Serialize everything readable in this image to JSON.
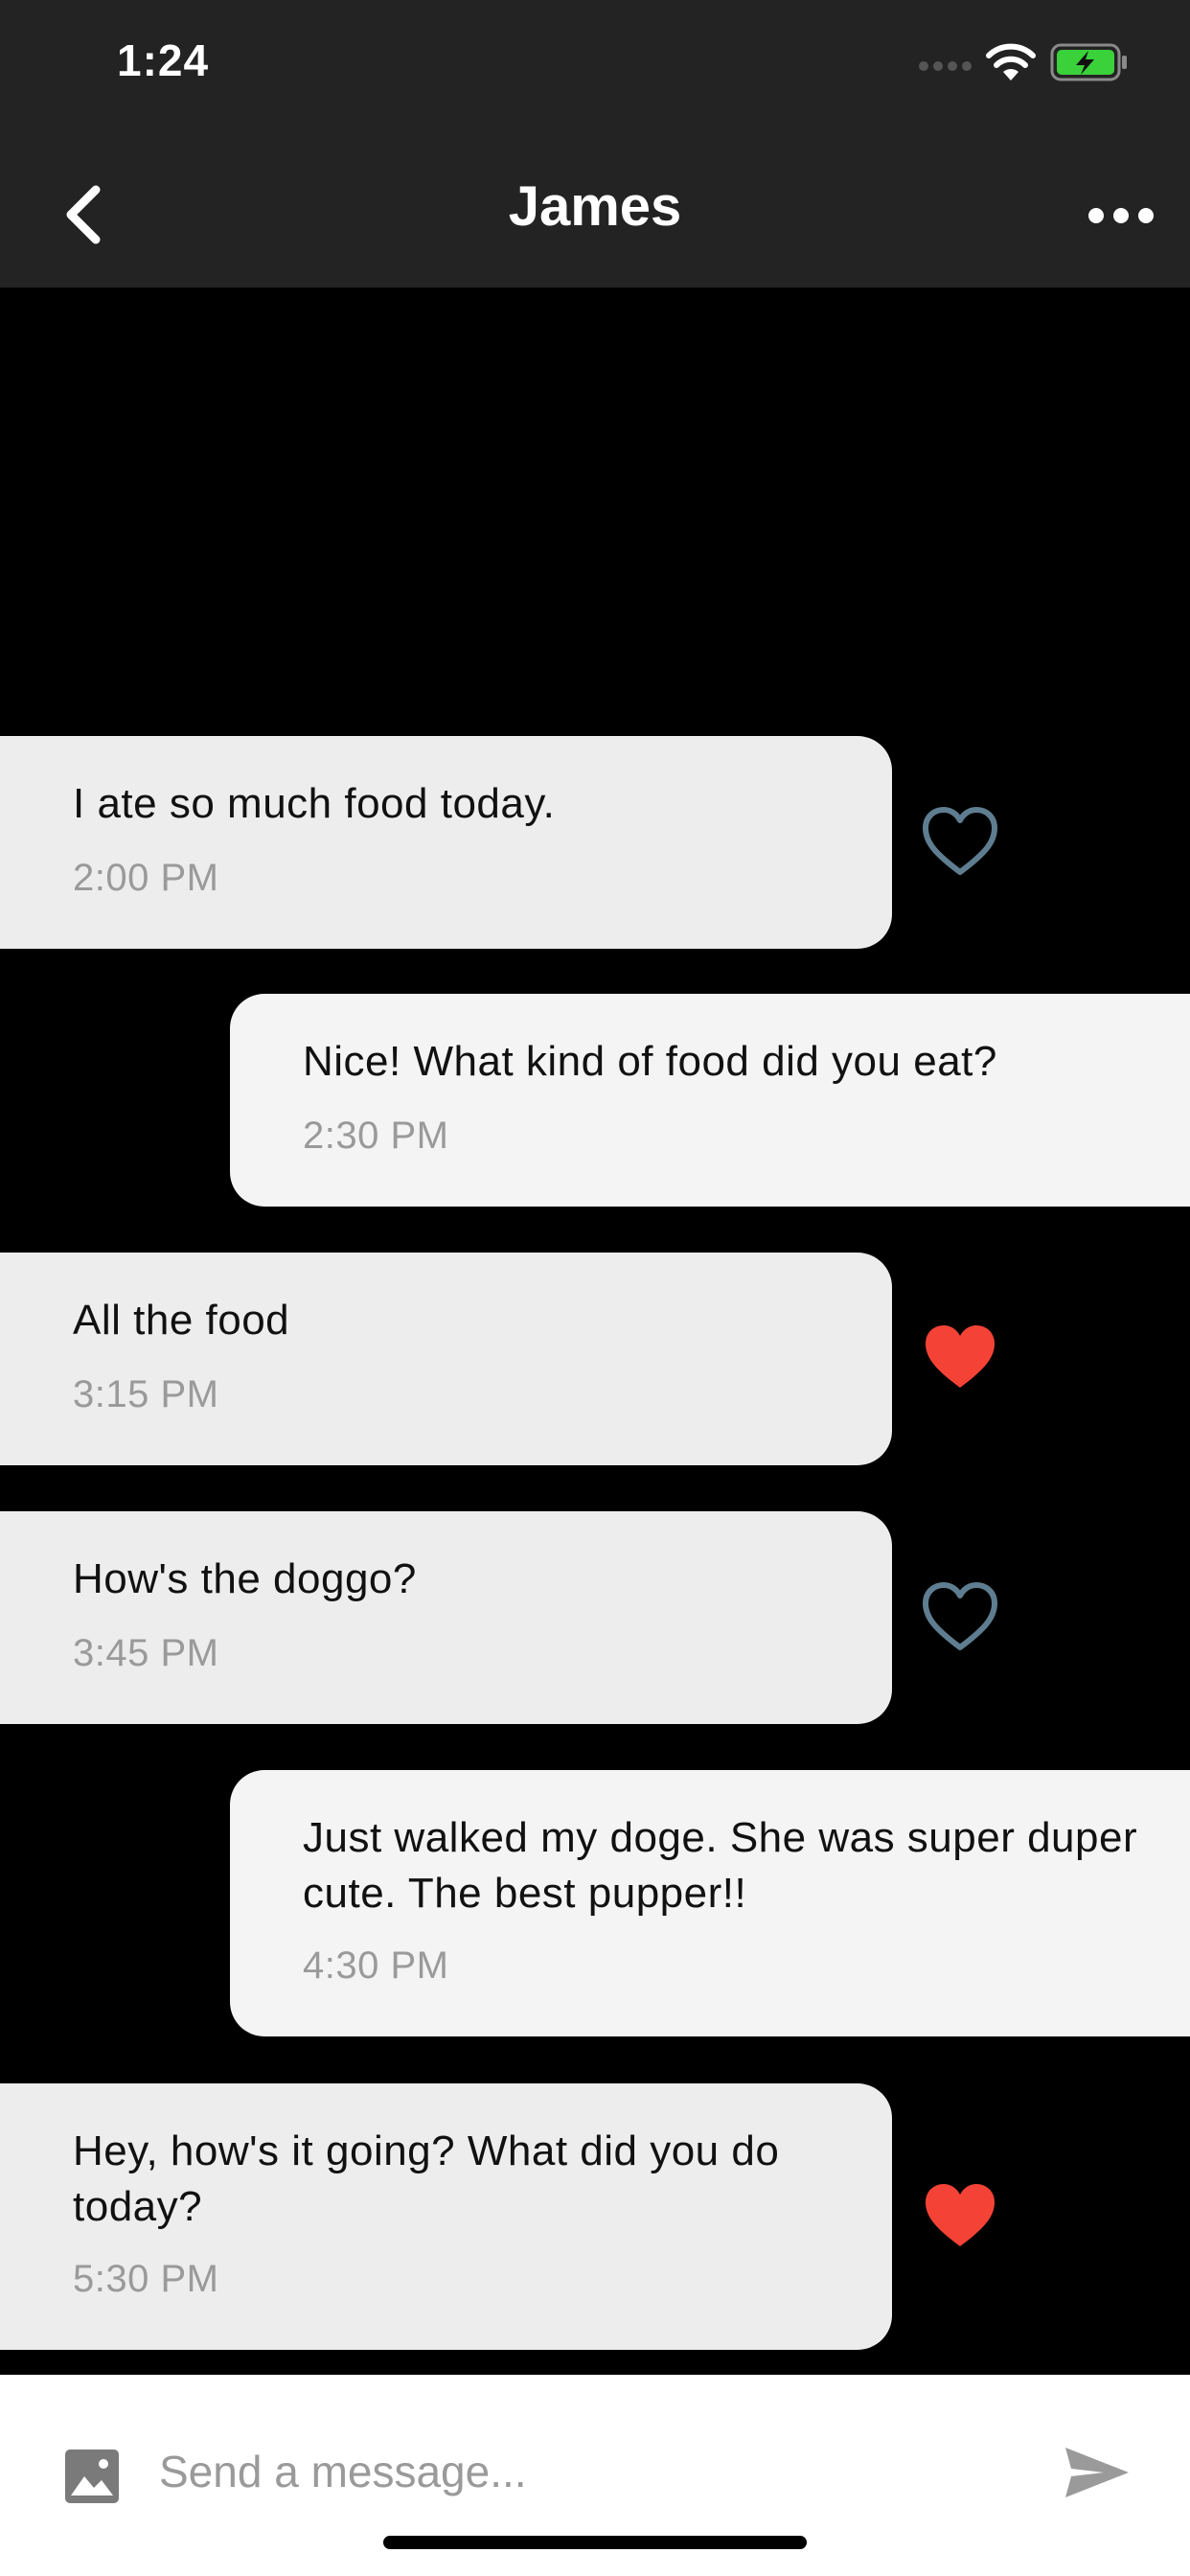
{
  "status_bar": {
    "time": "1:24",
    "icons": [
      "signal-icon",
      "wifi-icon",
      "battery-charging-icon"
    ]
  },
  "nav": {
    "title": "James",
    "back_icon": "chevron-left-icon",
    "more_icon": "more-horizontal-icon"
  },
  "messages": [
    {
      "direction": "received",
      "text": "I ate so much food today.",
      "time": "2:00 PM",
      "liked": false
    },
    {
      "direction": "sent",
      "text": "Nice! What kind of food did you eat?",
      "time": "2:30 PM"
    },
    {
      "direction": "received",
      "text": "All the food",
      "time": "3:15 PM",
      "liked": true
    },
    {
      "direction": "received",
      "text": "How's the doggo?",
      "time": "3:45 PM",
      "liked": false
    },
    {
      "direction": "sent",
      "text": "Just walked my doge. She was super duper cute. The best pupper!!",
      "time": "4:30 PM"
    },
    {
      "direction": "received",
      "text": "Hey, how's it going? What did you do today?",
      "time": "5:30 PM",
      "liked": true
    }
  ],
  "composer": {
    "placeholder": "Send a message...",
    "value": "",
    "image_icon": "image-icon",
    "send_icon": "send-icon"
  },
  "colors": {
    "bar_background": "#232323",
    "chat_background": "#000000",
    "received_bubble": "#ededed",
    "sent_bubble": "#f4f4f4",
    "heart_liked": "#f44336",
    "heart_outline": "#5f7d90"
  }
}
